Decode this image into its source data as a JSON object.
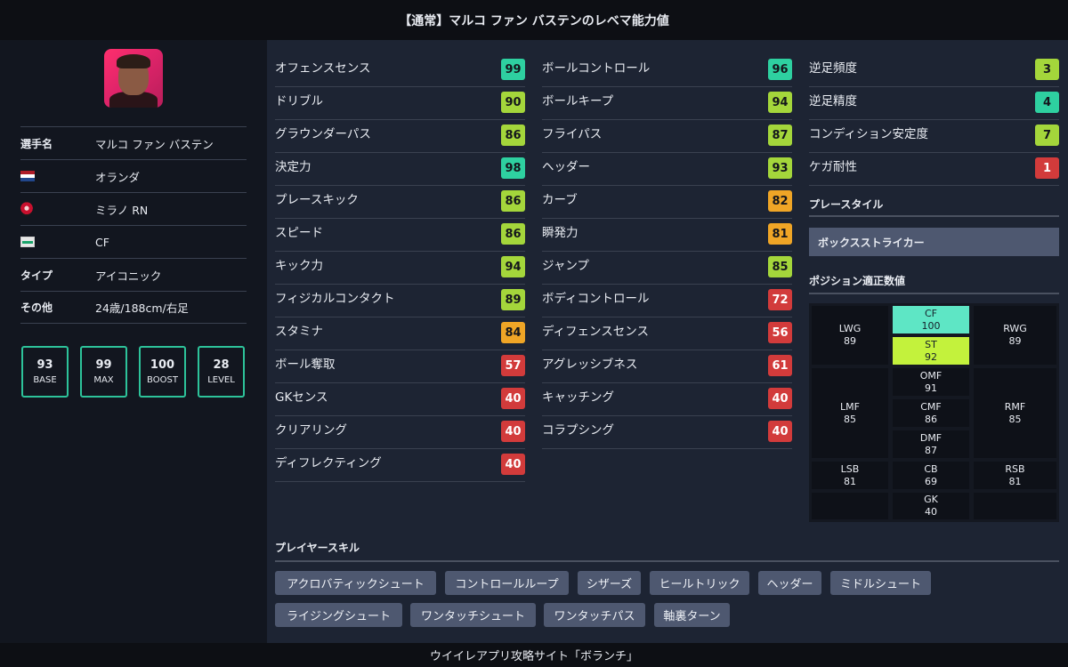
{
  "header": {
    "title": "【通常】マルコ ファン バステンのレベマ能力値"
  },
  "footer": {
    "text": "ウイイレアプリ攻略サイト「ボランチ」"
  },
  "player": {
    "name_label": "選手名",
    "name": "マルコ ファン バステン",
    "nationality": "オランダ",
    "club": "ミラノ RN",
    "position": "CF",
    "type_label": "タイプ",
    "type": "アイコニック",
    "other_label": "その他",
    "other": "24歳/188cm/右足",
    "icons": {
      "flag": "netherlands-flag-icon",
      "club": "club-crest-icon",
      "position": "position-icon"
    }
  },
  "summary": [
    {
      "value": "93",
      "label": "BASE"
    },
    {
      "value": "99",
      "label": "MAX"
    },
    {
      "value": "100",
      "label": "BOOST"
    },
    {
      "value": "28",
      "label": "LEVEL"
    }
  ],
  "stats_col1": [
    {
      "name": "オフェンスセンス",
      "value": "99",
      "tier": "teal"
    },
    {
      "name": "ドリブル",
      "value": "90",
      "tier": "green"
    },
    {
      "name": "グラウンダーパス",
      "value": "86",
      "tier": "green"
    },
    {
      "name": "決定力",
      "value": "98",
      "tier": "teal"
    },
    {
      "name": "プレースキック",
      "value": "86",
      "tier": "green"
    },
    {
      "name": "スピード",
      "value": "86",
      "tier": "green"
    },
    {
      "name": "キック力",
      "value": "94",
      "tier": "green"
    },
    {
      "name": "フィジカルコンタクト",
      "value": "89",
      "tier": "green"
    },
    {
      "name": "スタミナ",
      "value": "84",
      "tier": "orange"
    },
    {
      "name": "ボール奪取",
      "value": "57",
      "tier": "red"
    },
    {
      "name": "GKセンス",
      "value": "40",
      "tier": "red"
    },
    {
      "name": "クリアリング",
      "value": "40",
      "tier": "red"
    },
    {
      "name": "ディフレクティング",
      "value": "40",
      "tier": "red"
    }
  ],
  "stats_col2": [
    {
      "name": "ボールコントロール",
      "value": "96",
      "tier": "teal"
    },
    {
      "name": "ボールキープ",
      "value": "94",
      "tier": "green"
    },
    {
      "name": "フライパス",
      "value": "87",
      "tier": "green"
    },
    {
      "name": "ヘッダー",
      "value": "93",
      "tier": "green"
    },
    {
      "name": "カーブ",
      "value": "82",
      "tier": "orange"
    },
    {
      "name": "瞬発力",
      "value": "81",
      "tier": "orange"
    },
    {
      "name": "ジャンプ",
      "value": "85",
      "tier": "green"
    },
    {
      "name": "ボディコントロール",
      "value": "72",
      "tier": "red"
    },
    {
      "name": "ディフェンスセンス",
      "value": "56",
      "tier": "red"
    },
    {
      "name": "アグレッシブネス",
      "value": "61",
      "tier": "red"
    },
    {
      "name": "キャッチング",
      "value": "40",
      "tier": "red"
    },
    {
      "name": "コラプシング",
      "value": "40",
      "tier": "red"
    }
  ],
  "stats_col3": [
    {
      "name": "逆足頻度",
      "value": "3",
      "tier": "green"
    },
    {
      "name": "逆足精度",
      "value": "4",
      "tier": "teal"
    },
    {
      "name": "コンディション安定度",
      "value": "7",
      "tier": "green"
    },
    {
      "name": "ケガ耐性",
      "value": "1",
      "tier": "red"
    }
  ],
  "play_style": {
    "title": "プレースタイル",
    "value": "ボックスストライカー"
  },
  "positions": {
    "title": "ポジション適正数値",
    "LWG": "89",
    "CF": "100",
    "RWG": "89",
    "ST": "92",
    "LMF": "85",
    "OMF": "91",
    "RMF": "85",
    "CMF": "86",
    "DMF": "87",
    "LSB": "81",
    "CB": "69",
    "RSB": "81",
    "GK": "40",
    "labels": {
      "LWG": "LWG",
      "CF": "CF",
      "RWG": "RWG",
      "ST": "ST",
      "LMF": "LMF",
      "OMF": "OMF",
      "RMF": "RMF",
      "CMF": "CMF",
      "DMF": "DMF",
      "LSB": "LSB",
      "CB": "CB",
      "RSB": "RSB",
      "GK": "GK"
    },
    "colors": {
      "best": "#5ee6c5",
      "good": "#c3f23c"
    }
  },
  "skills": {
    "title": "プレイヤースキル",
    "items": [
      "アクロバティックシュート",
      "コントロールループ",
      "シザーズ",
      "ヒールトリック",
      "ヘッダー",
      "ミドルシュート",
      "ライジングシュート",
      "ワンタッチシュート",
      "ワンタッチパス",
      "軸裏ターン"
    ]
  },
  "colors": {
    "teal": "#2ed0a0",
    "green": "#a4d63b",
    "orange": "#efa526",
    "red": "#d23b3b",
    "box_border": "#2dc39a"
  }
}
